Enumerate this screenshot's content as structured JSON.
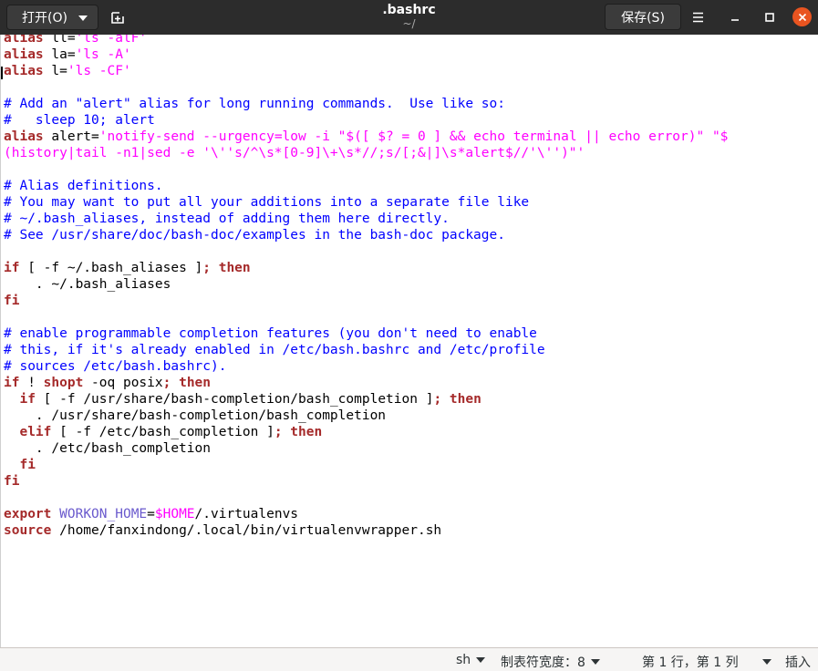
{
  "header": {
    "open_label": "打开(O)",
    "title": ".bashrc",
    "subtitle": "~/",
    "save_label": "保存(S)"
  },
  "editor": {
    "lines": [
      [
        {
          "t": "alias",
          "c": "kw"
        },
        {
          "t": " ll="
        },
        {
          "t": "'ls -alF'",
          "c": "str"
        }
      ],
      [
        {
          "t": "alias",
          "c": "kw"
        },
        {
          "t": " la="
        },
        {
          "t": "'ls -A'",
          "c": "str"
        }
      ],
      [
        {
          "t": "alias",
          "c": "kw"
        },
        {
          "t": " l="
        },
        {
          "t": "'ls -CF'",
          "c": "str"
        }
      ],
      [],
      [
        {
          "t": "# Add an \"alert\" alias for long running commands.  Use like so:",
          "c": "cm"
        }
      ],
      [
        {
          "t": "#   sleep 10; alert",
          "c": "cm"
        }
      ],
      [
        {
          "t": "alias",
          "c": "kw"
        },
        {
          "t": " alert="
        },
        {
          "t": "'notify-send --urgency=low -i \"$([ $? = 0 ] && echo terminal || echo error)\" \"$",
          "c": "str"
        }
      ],
      [
        {
          "t": "(history|tail -n1|sed -e '\\''s/^\\s*[0-9]\\+\\s*//;s/[;&|]\\s*alert$//'\\'')\"'",
          "c": "str"
        }
      ],
      [],
      [
        {
          "t": "# Alias definitions.",
          "c": "cm"
        }
      ],
      [
        {
          "t": "# You may want to put all your additions into a separate file like",
          "c": "cm"
        }
      ],
      [
        {
          "t": "# ~/.bash_aliases, instead of adding them here directly.",
          "c": "cm"
        }
      ],
      [
        {
          "t": "# See /usr/share/doc/bash-doc/examples in the bash-doc package.",
          "c": "cm"
        }
      ],
      [],
      [
        {
          "t": "if",
          "c": "kw"
        },
        {
          "t": " [ -f ~/.bash_aliases ]"
        },
        {
          "t": "; then",
          "c": "kw"
        }
      ],
      [
        {
          "t": "    . ~/.bash_aliases"
        }
      ],
      [
        {
          "t": "fi",
          "c": "kw"
        }
      ],
      [],
      [
        {
          "t": "# enable programmable completion features (you don't need to enable",
          "c": "cm"
        }
      ],
      [
        {
          "t": "# this, if it's already enabled in /etc/bash.bashrc and /etc/profile",
          "c": "cm"
        }
      ],
      [
        {
          "t": "# sources /etc/bash.bashrc).",
          "c": "cm"
        }
      ],
      [
        {
          "t": "if",
          "c": "kw"
        },
        {
          "t": " ! "
        },
        {
          "t": "shopt",
          "c": "kw"
        },
        {
          "t": " -oq posix"
        },
        {
          "t": "; then",
          "c": "kw"
        }
      ],
      [
        {
          "t": "  "
        },
        {
          "t": "if",
          "c": "kw"
        },
        {
          "t": " [ -f /usr/share/bash-completion/bash_completion ]"
        },
        {
          "t": "; then",
          "c": "kw"
        }
      ],
      [
        {
          "t": "    . /usr/share/bash-completion/bash_completion"
        }
      ],
      [
        {
          "t": "  "
        },
        {
          "t": "elif",
          "c": "kw"
        },
        {
          "t": " [ -f /etc/bash_completion ]"
        },
        {
          "t": "; then",
          "c": "kw"
        }
      ],
      [
        {
          "t": "    . /etc/bash_completion"
        }
      ],
      [
        {
          "t": "  "
        },
        {
          "t": "fi",
          "c": "kw"
        }
      ],
      [
        {
          "t": "fi",
          "c": "kw"
        }
      ],
      [],
      [
        {
          "t": "export",
          "c": "kw"
        },
        {
          "t": " "
        },
        {
          "t": "WORKON_HOME",
          "c": "var"
        },
        {
          "t": "="
        },
        {
          "t": "$HOME",
          "c": "str"
        },
        {
          "t": "/.virtualenvs"
        }
      ],
      [
        {
          "t": "source",
          "c": "kw"
        },
        {
          "t": " /home/fanxindong/.local/bin/virtualenvwrapper.sh"
        }
      ]
    ]
  },
  "status": {
    "language": "sh",
    "tab_width": "制表符宽度：8",
    "position": "第 1 行，第 1 列",
    "mode": "插入"
  }
}
